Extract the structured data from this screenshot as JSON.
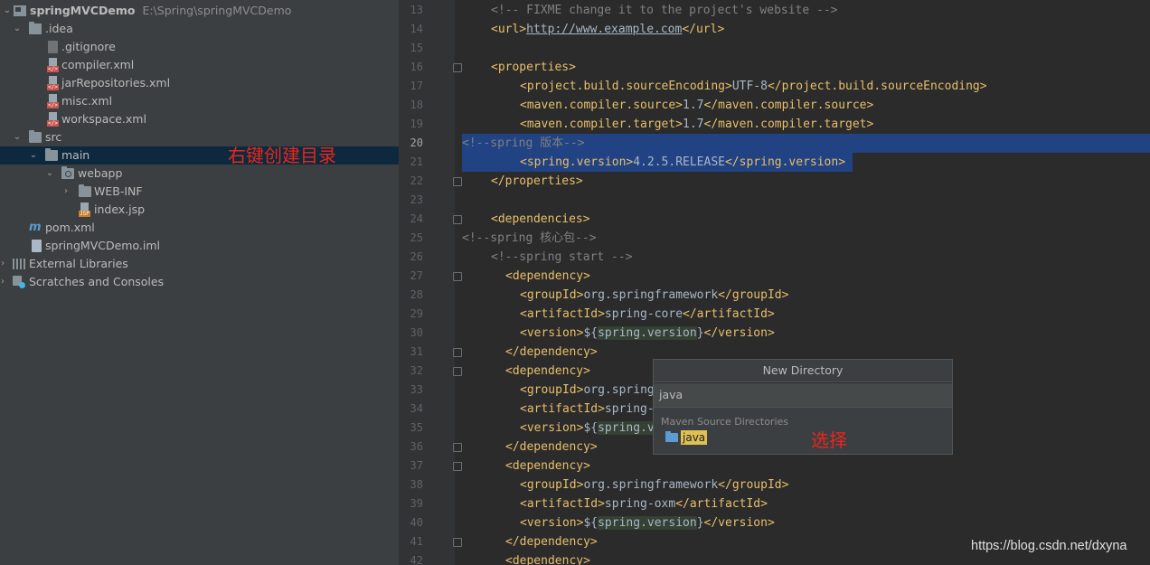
{
  "tree": {
    "project_name": "springMVCDemo",
    "project_path": "E:\\Spring\\springMVCDemo",
    "idea": ".idea",
    "idea_files": [
      ".gitignore",
      "compiler.xml",
      "jarRepositories.xml",
      "misc.xml",
      "workspace.xml"
    ],
    "src": "src",
    "main": "main",
    "webapp": "webapp",
    "web_inf": "WEB-INF",
    "index_jsp": "index.jsp",
    "pom": "pom.xml",
    "iml": "springMVCDemo.iml",
    "external_libraries": "External Libraries",
    "scratches": "Scratches and Consoles"
  },
  "annotations": {
    "right_click": "右键创建目录",
    "choose": "选择"
  },
  "editor": {
    "line_numbers": [
      "13",
      "14",
      "15",
      "16",
      "17",
      "18",
      "19",
      "20",
      "21",
      "22",
      "23",
      "24",
      "25",
      "26",
      "27",
      "28",
      "29",
      "30",
      "31",
      "32",
      "33",
      "34",
      "35",
      "36",
      "37",
      "38",
      "39",
      "40",
      "41",
      "42"
    ],
    "current_line": "20",
    "code": {
      "l13": "<!-- FIXME change it to the project's website -->",
      "l14_open": "<url>",
      "l14_url": "http://www.example.com",
      "l14_close": "</url>",
      "l16": "<properties>",
      "l17_open": "<project.build.sourceEncoding>",
      "l17_val": "UTF-8",
      "l17_close": "</project.build.sourceEncoding>",
      "l18_open": "<maven.compiler.source>",
      "l18_val": "1.7",
      "l18_close": "</maven.compiler.source>",
      "l19_open": "<maven.compiler.target>",
      "l19_val": "1.7",
      "l19_close": "</maven.compiler.target>",
      "l20": "<!--spring 版本-->",
      "l21_open": "<spring.version>",
      "l21_val": "4.2.5.RELEASE",
      "l21_close": "</spring.version>",
      "l22": "</properties>",
      "l24": "<dependencies>",
      "l25": "<!--spring 核心包-->",
      "l26": "<!--spring start -->",
      "dep_open": "<dependency>",
      "dep_close": "</dependency>",
      "gid_open": "<groupId>",
      "gid_val": "org.springframework",
      "gid_close": "</groupId>",
      "gid_partial": "org.spring",
      "aid_open": "<artifactId>",
      "aid_close": "</artifactId>",
      "aid_core": "spring-core",
      "aid_partial": "spring-",
      "aid_oxm": "spring-oxm",
      "ver_open": "<version>",
      "ver_dollar": "${",
      "ver_prop": "spring.version",
      "ver_prop_partial": "spring.v",
      "ver_end": "}",
      "ver_close": "</version>"
    }
  },
  "popup": {
    "title": "New Directory",
    "input_value": "java",
    "section": "Maven Source Directories",
    "option": "java"
  },
  "watermark": "https://blog.csdn.net/dxyna"
}
